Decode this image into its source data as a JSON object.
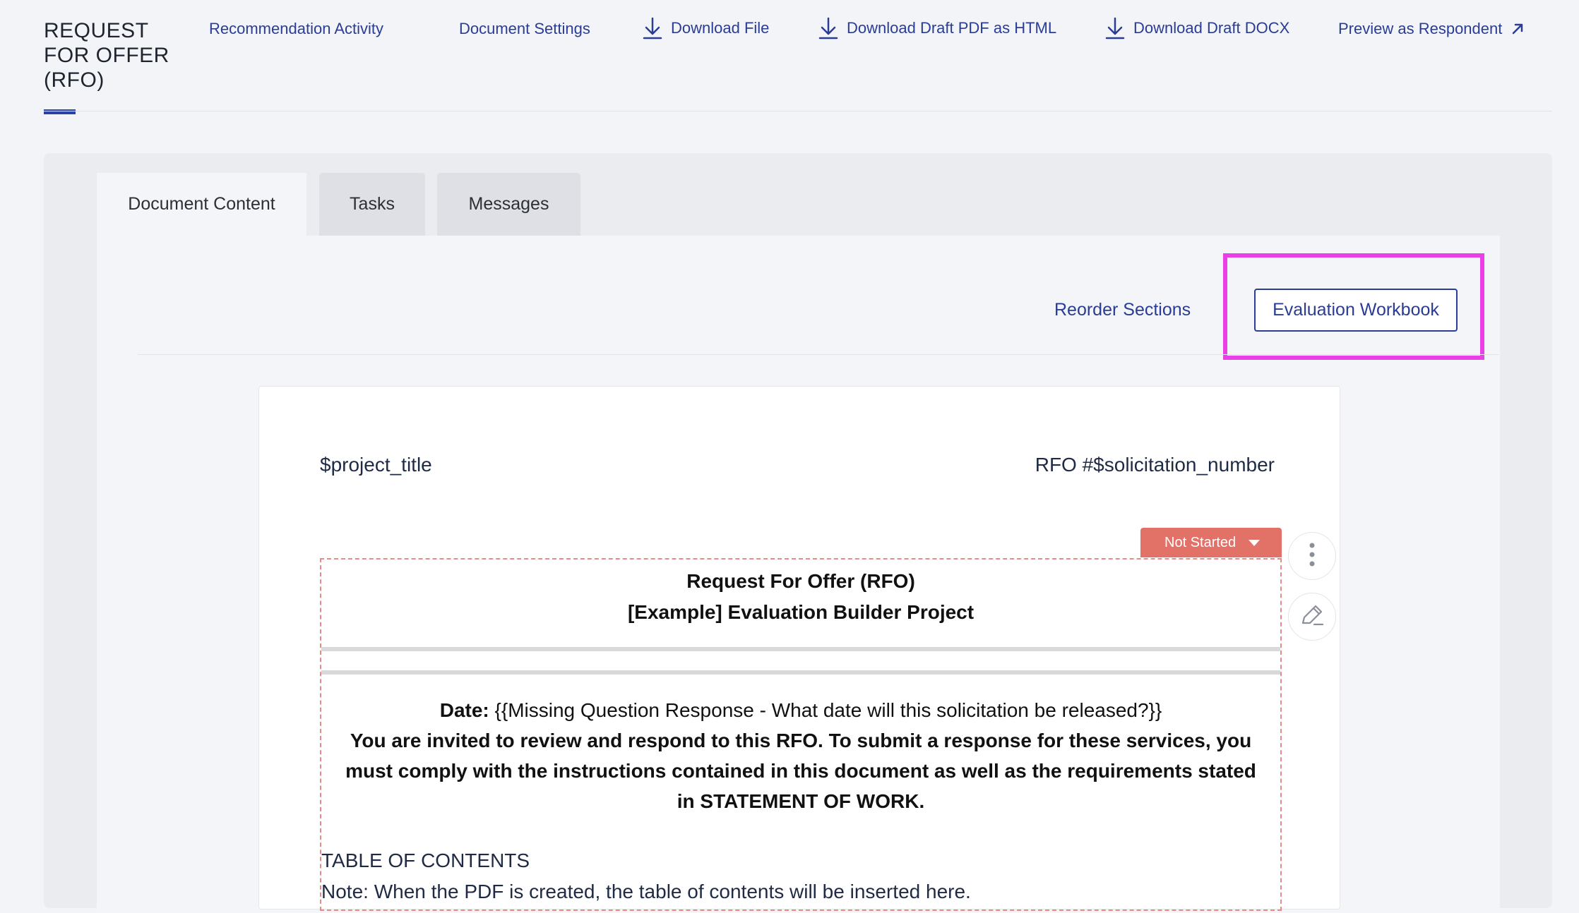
{
  "nav": {
    "title": "REQUEST\nFOR OFFER\n(RFO)",
    "links": {
      "recommendation": "Recommendation Activity",
      "settings": "Document Settings",
      "download_file": "Download File",
      "download_pdf": "Download Draft PDF as HTML",
      "download_docx": "Download Draft DOCX",
      "preview": "Preview as Respondent"
    },
    "icons": {
      "download": "download-icon",
      "external": "external-link-icon"
    }
  },
  "tabs": [
    {
      "label": "Document Content",
      "active": true
    },
    {
      "label": "Tasks",
      "active": false
    },
    {
      "label": "Messages",
      "active": false
    }
  ],
  "toolbar": {
    "reorder": "Reorder Sections",
    "evaluation_workbook": "Evaluation Workbook"
  },
  "document": {
    "header_left": "$project_title",
    "header_right": "RFO #$solicitation_number",
    "section": {
      "status": "Not Started",
      "heading_1": "Request For Offer (RFO)",
      "heading_2": "[Example] Evaluation Builder Project",
      "date_label": "Date:",
      "date_value": " {{Missing Question Response - What date will this solicitation be released?}}",
      "invite_line_1": "You are invited to review and respond to this RFO.  To submit a response for these services, you",
      "invite_line_2": "must comply with the instructions contained in this document as well as the requirements stated",
      "invite_line_3": "in STATEMENT OF WORK.",
      "toc_title": "TABLE OF CONTENTS",
      "toc_note": "Note: When the PDF is created, the table of contents will be inserted here."
    }
  },
  "colors": {
    "accent": "#2a3c94",
    "highlight": "#ea3fe8",
    "status_not_started": "#e27168"
  }
}
